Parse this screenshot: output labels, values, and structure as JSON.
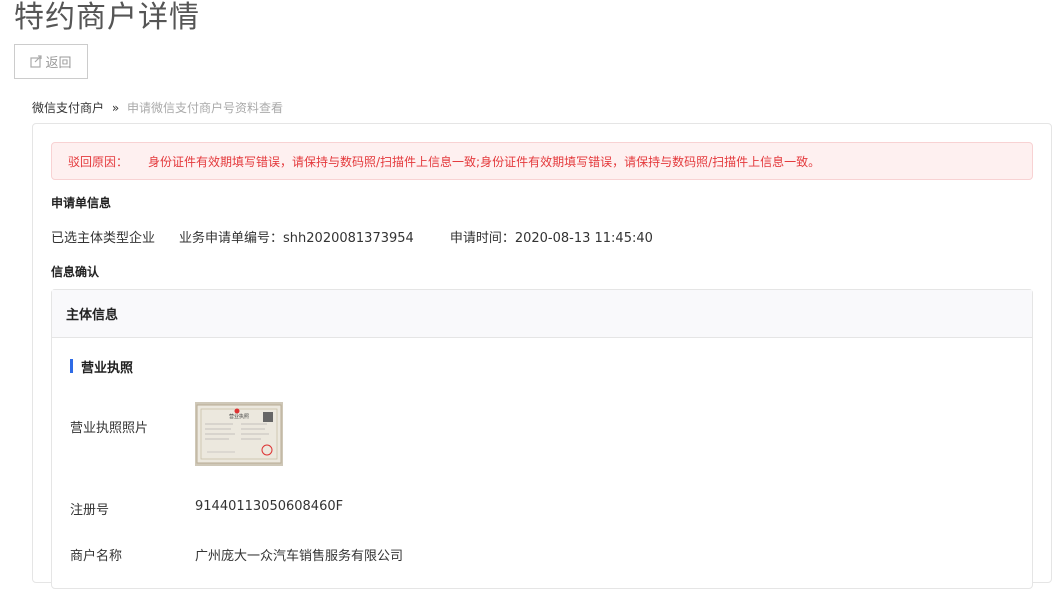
{
  "page": {
    "title": "特约商户详情"
  },
  "toolbar": {
    "back_label": "返回",
    "back_icon": "share-icon"
  },
  "breadcrumb": {
    "parent": "微信支付商户",
    "separator": "»",
    "current": "申请微信支付商户号资料查看"
  },
  "alert": {
    "label": "驳回原因：",
    "message": "身份证件有效期填写错误，请保持与数码照/扫描件上信息一致;身份证件有效期填写错误，请保持与数码照/扫描件上信息一致。"
  },
  "application": {
    "section_title": "申请单信息",
    "subject_type": "已选主体类型企业",
    "business_no_label": "业务申请单编号：",
    "business_no": "shh2020081373954",
    "apply_time_label": "申请时间：",
    "apply_time": "2020-08-13 11:45:40"
  },
  "confirm": {
    "section_title": "信息确认",
    "subject_header": "主体信息",
    "license_title": "营业执照",
    "fields": {
      "photo_label": "营业执照照片",
      "reg_no_label": "注册号",
      "reg_no": "91440113050608460F",
      "name_label": "商户名称",
      "name": "广州庞大一众汽车销售服务有限公司"
    },
    "license_image": {
      "heading": "营业执照"
    }
  },
  "colors": {
    "accent": "#2e6be6",
    "alert_text": "#e4393c",
    "alert_bg": "#fef0f0",
    "muted": "#aaaaaa"
  }
}
